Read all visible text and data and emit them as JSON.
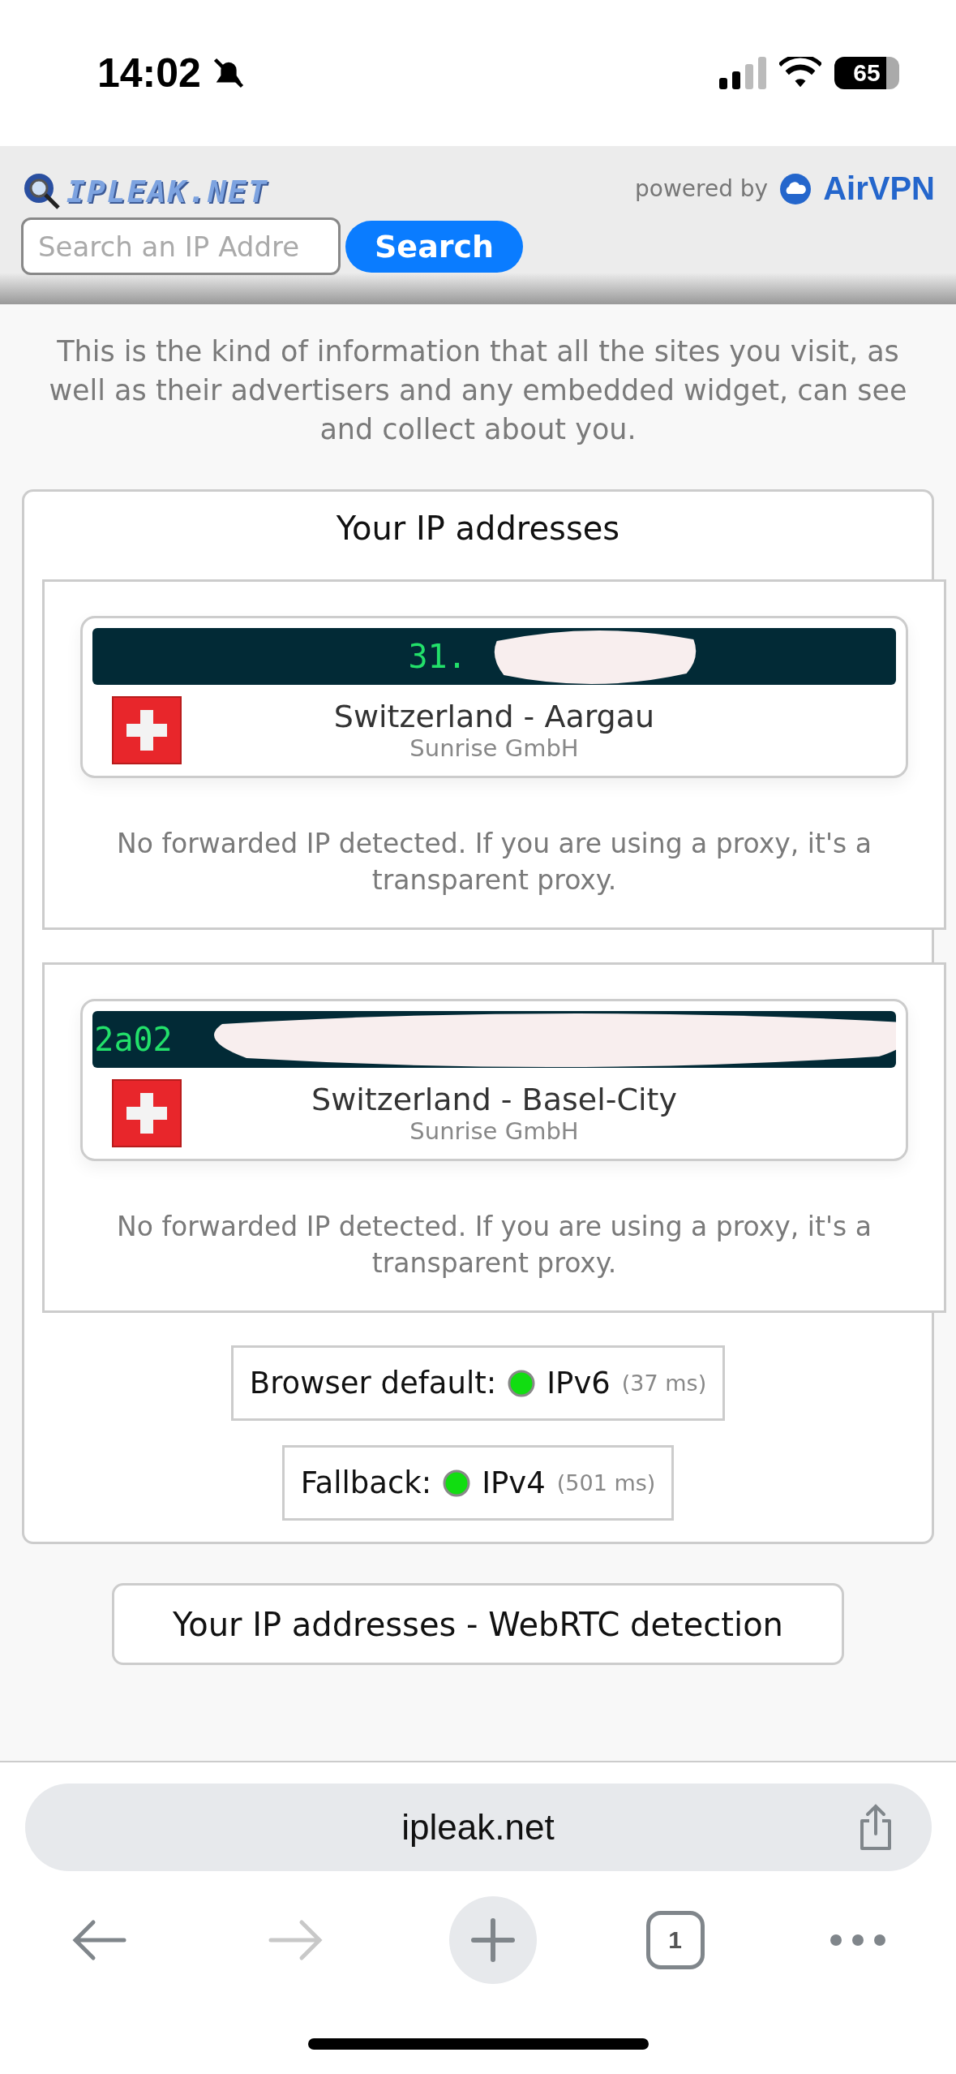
{
  "status_bar": {
    "time": "14:02",
    "silent": true,
    "battery": "65"
  },
  "header": {
    "logo": "IPLEAK.NET",
    "search": {
      "placeholder": "Search an IP Addre",
      "button": "Search"
    },
    "powered_by": "powered by",
    "sponsor": "AirVPN"
  },
  "intro": "This is the kind of information that all the sites you visit, as well as their advertisers and any embedded widget, can see and collect about you.",
  "ip_section": {
    "title": "Your IP addresses",
    "addresses": [
      {
        "ip": "31.",
        "location": "Switzerland - Aargau",
        "isp": "Sunrise GmbH",
        "forwarded": "No forwarded IP detected. If you are using a proxy, it's a transparent proxy."
      },
      {
        "ip": "2a02",
        "location": "Switzerland - Basel-City",
        "isp": "Sunrise GmbH",
        "forwarded": "No forwarded IP detected. If you are using a proxy, it's a transparent proxy."
      }
    ],
    "protocols": [
      {
        "label": "Browser default:",
        "ok": true,
        "protocol": "IPv6",
        "latency": "(37 ms)"
      },
      {
        "label": "Fallback:",
        "ok": true,
        "protocol": "IPv4",
        "latency": "(501 ms)"
      }
    ]
  },
  "webrtc_button": "Your IP addresses - WebRTC detection",
  "browser": {
    "url": "ipleak.net",
    "tabs_count": "1",
    "back_disabled": false,
    "forward_disabled": true
  }
}
